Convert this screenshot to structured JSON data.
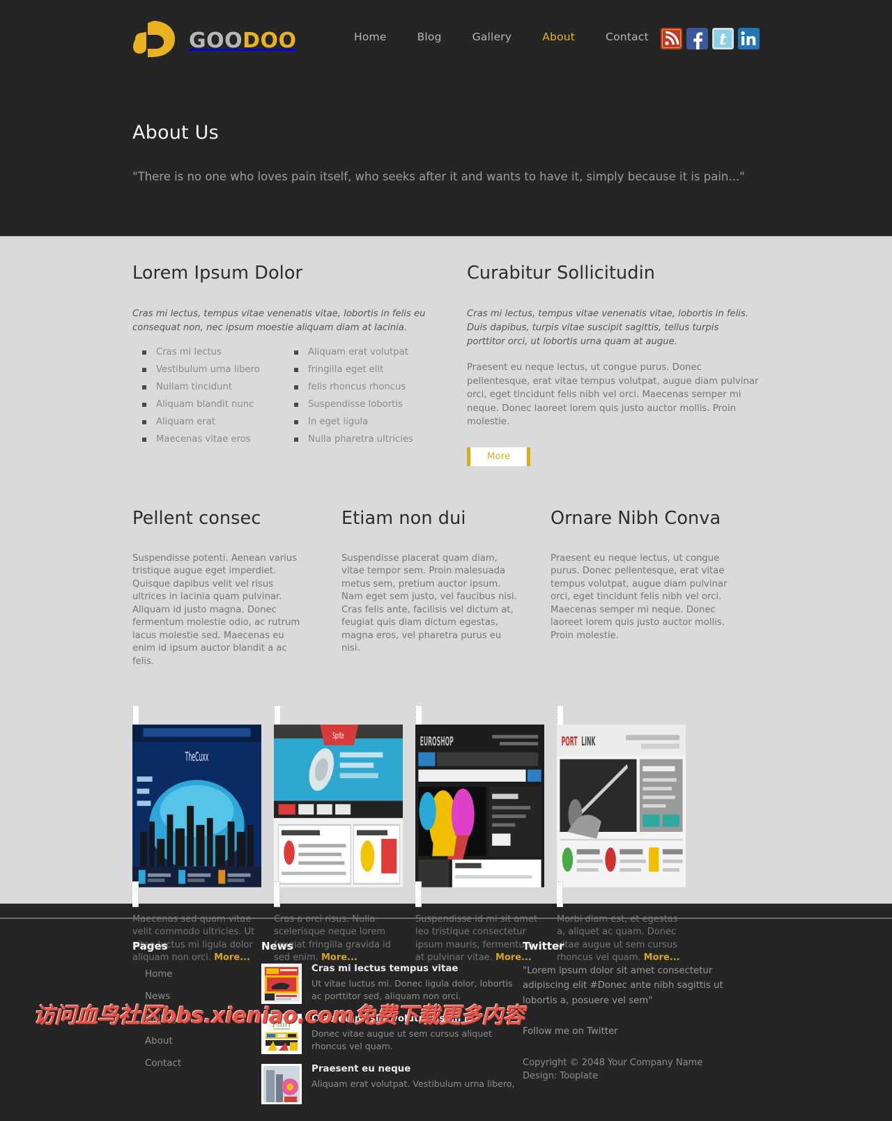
{
  "site": {
    "logo_text_1": "GOO",
    "logo_text_2": "DOO",
    "accent": "#e8b220",
    "dark_bg": "#252525",
    "light_bg": "#dadada"
  },
  "nav": {
    "items": [
      {
        "label": "Home",
        "active": false
      },
      {
        "label": "Blog",
        "active": false
      },
      {
        "label": "Gallery",
        "active": false
      },
      {
        "label": "About",
        "active": true
      },
      {
        "label": "Contact",
        "active": false
      }
    ]
  },
  "social": [
    {
      "name": "rss-icon",
      "label": "RSS",
      "color": "#c0392b"
    },
    {
      "name": "facebook-icon",
      "label": "Facebook",
      "color": "#3b5998"
    },
    {
      "name": "twitter-icon",
      "label": "Twitter",
      "color": "#7fc7e8"
    },
    {
      "name": "linkedin-icon",
      "label": "LinkedIn",
      "color": "#2178b5"
    }
  ],
  "hero": {
    "title": "About Us",
    "quote": "\"There is no one who loves pain itself, who seeks after it and wants to have it, simply because it is pain...\""
  },
  "main": {
    "left": {
      "title": "Lorem Ipsum Dolor",
      "lead": "Cras mi lectus, tempus vitae venenatis vitae, lobortis in felis eu consequat non, nec ipsum moestie aliquam diam at lacinia.",
      "list_1": [
        "Cras mi lectus",
        "Vestibulum urna libero",
        "Nullam tincidunt",
        "Aliquam blandit nunc",
        "Aliquam erat",
        "Maecenas vitae eros"
      ],
      "list_2": [
        "Aliquam erat volutpat",
        "fringilla eget elit",
        "felis rhoncus rhoncus",
        "Suspendisse lobortis",
        "In eget ligula",
        "Nulla pharetra ultricies"
      ]
    },
    "right": {
      "title": "Curabitur Sollicitudin",
      "lead": "Cras mi lectus, tempus vitae venenatis vitae, lobortis in felis. Duis dapibus, turpis vitae suscipit sagittis, tellus turpis porttitor orci, ut lobortis urna quam at augue.",
      "body": "Praesent eu neque lectus, ut congue purus. Donec pellentesque, erat vitae tempus volutpat, augue diam pulvinar orci, eget tincidunt felis nibh vel orci. Maecenas semper mi neque. Donec laoreet lorem quis justo auctor mollis. Proin molestie.",
      "more_label": "More"
    },
    "columns": [
      {
        "title": "Pellent consec",
        "body": "Suspendisse potenti. Aenean varius tristique augue eget imperdiet. Quisque dapibus velit vel risus ultrices in lacinia quam pulvinar. Aliquam id justo magna. Donec fermentum molestie odio, ac rutrum lacus molestie sed. Maecenas eu enim id ipsum auctor blandit a ac felis."
      },
      {
        "title": "Etiam non dui",
        "body": "Suspendisse placerat quam diam, vitae tempor sem. Proin malesuada metus sem, pretium auctor ipsum. Nam eget sem justo, vel faucibus nisi. Cras felis ante, facilisis vel dictum at, feugiat quis diam dictum egestas, magna eros, vel pharetra purus eu nisi."
      },
      {
        "title": "Ornare Nibh Conva",
        "body": "Praesent eu neque lectus, ut congue purus. Donec pellentesque, erat vitae tempus volutpat, augue diam pulvinar orci, eget tincidunt felis nibh vel orci. Maecenas semper mi neque. Donec laoreet lorem quis justo auctor mollis. Proin molestie."
      }
    ],
    "thumbs": [
      {
        "alt": "thecuxx website screenshot",
        "text": "Maecenas sed quam vitae velit commodo ultricies. Ut vitae luctus mi ligula dolor aliquam non orci.",
        "more": "More..."
      },
      {
        "alt": "sprite agency website screenshot",
        "text": "Cras a orci risus. Nulla scelerisque neque lorem feugiat fringilla gravida id sed enim.",
        "more": "More..."
      },
      {
        "alt": "euroshop ecommerce website screenshot",
        "text": "Suspendisse id mi sit amet leo tristique consectetur ipsum mauris, fermentum at pulvinar vitae.",
        "more": "More..."
      },
      {
        "alt": "portlink corporate website screenshot",
        "text": "Morbi diam est, et egestas a, aliquet ac quam. Donec vitae augue ut sem cursus rhoncus vel quam.",
        "more": "More..."
      }
    ]
  },
  "footer": {
    "pages": {
      "title": "Pages",
      "items": [
        "Home",
        "News",
        "Gallery",
        "About",
        "Contact"
      ]
    },
    "news": {
      "title": "News",
      "items": [
        {
          "title": "Cras mi lectus tempus vitae",
          "text": "Ut vitae luctus mi. Donec ligula dolor, lobortis ac porttitor sed, aliquam non orci."
        },
        {
          "title": "Cras dignissim volutpat sem id",
          "text": "Donec vitae augue ut sem cursus aliquet rhoncus vel quam."
        },
        {
          "title": "Praesent eu neque",
          "text": "Aliquam erat volutpat. Vestibulum urna libero,"
        }
      ]
    },
    "twitter": {
      "title": "Twitter",
      "quote": "\"Lorem ipsum dolor sit amet consectetur adipiscing elit #Donec ante nibh sagittis ut lobortis a, posuere vel sem\"",
      "follow": "Follow me on Twitter",
      "copyright": "Copyright © 2048 Your Company Name",
      "design": "Design: Tooplate"
    }
  },
  "watermark": {
    "text": "访问血鸟社区bbs.xieniao.com免费下载更多内容"
  }
}
